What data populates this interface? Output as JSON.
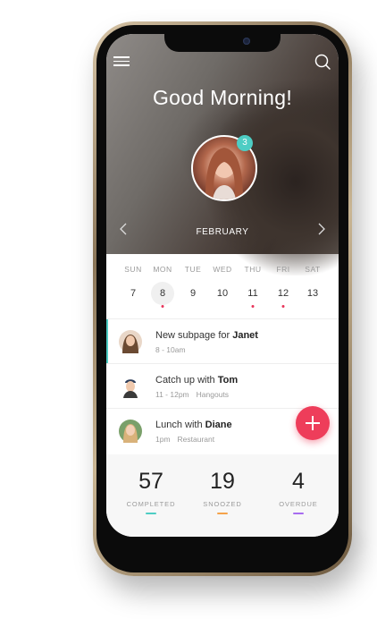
{
  "header": {
    "greeting": "Good Morning!",
    "notification_count": "3",
    "month": "FEBRUARY"
  },
  "calendar": {
    "days": [
      {
        "weekday": "SUN",
        "date": "7",
        "selected": false,
        "has_event": false
      },
      {
        "weekday": "MON",
        "date": "8",
        "selected": true,
        "has_event": true
      },
      {
        "weekday": "TUE",
        "date": "9",
        "selected": false,
        "has_event": false
      },
      {
        "weekday": "WED",
        "date": "10",
        "selected": false,
        "has_event": false
      },
      {
        "weekday": "THU",
        "date": "11",
        "selected": false,
        "has_event": true
      },
      {
        "weekday": "FRI",
        "date": "12",
        "selected": false,
        "has_event": true
      },
      {
        "weekday": "SAT",
        "date": "13",
        "selected": false,
        "has_event": false
      }
    ]
  },
  "events": [
    {
      "title": "New subpage for ",
      "person": "Janet",
      "time": "8 - 10am",
      "tag": "",
      "active": true
    },
    {
      "title": "Catch up with ",
      "person": "Tom",
      "time": "11 - 12pm",
      "tag": "Hangouts",
      "active": false
    },
    {
      "title": "Lunch with ",
      "person": "Diane",
      "time": "1pm",
      "tag": "Restaurant",
      "active": false
    }
  ],
  "stats": [
    {
      "value": "57",
      "label": "COMPLETED",
      "color": "#4ecdc4"
    },
    {
      "value": "19",
      "label": "SNOOZED",
      "color": "#f5a34a"
    },
    {
      "value": "4",
      "label": "OVERDUE",
      "color": "#a76cf0"
    }
  ],
  "icons": {
    "menu": "menu-icon",
    "search": "search-icon",
    "prev": "chevron-left-icon",
    "next": "chevron-right-icon",
    "add": "plus-icon"
  },
  "colors": {
    "accent": "#4ecdc4",
    "fab": "#ee3d5a",
    "event_dot": "#e8345a"
  }
}
